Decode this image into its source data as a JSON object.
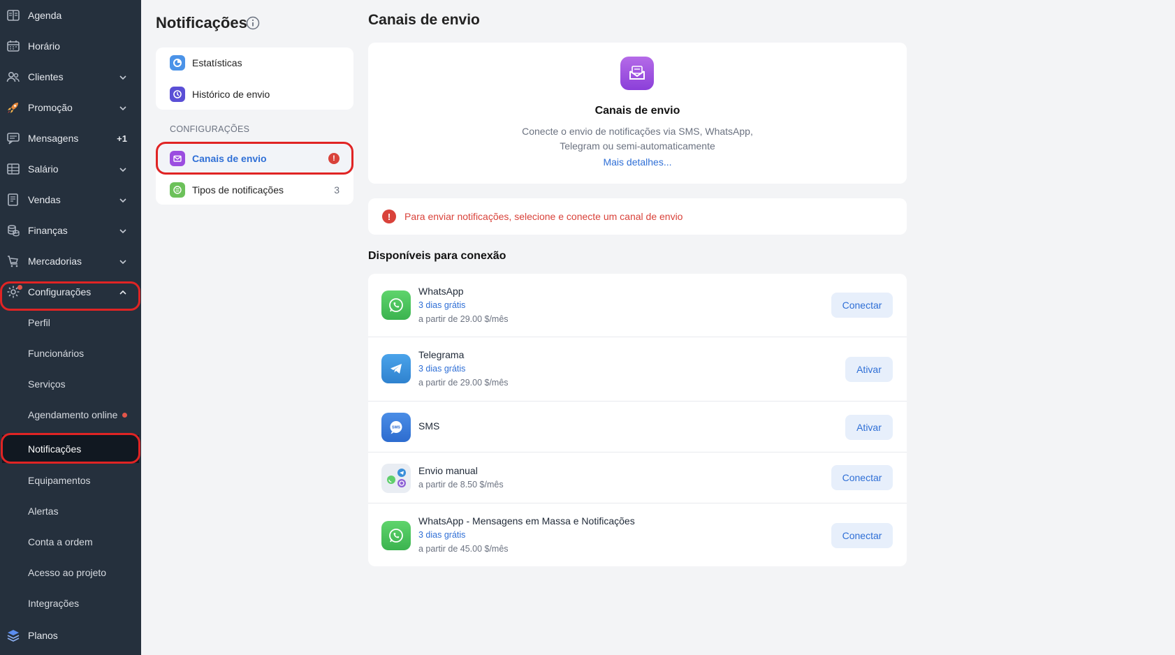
{
  "sidebar": {
    "items": [
      {
        "label": "Agenda",
        "icon": "calendar-book-icon"
      },
      {
        "label": "Horário",
        "icon": "calendar-icon"
      },
      {
        "label": "Clientes",
        "icon": "users-icon"
      },
      {
        "label": "Promoção",
        "icon": "rocket-icon"
      },
      {
        "label": "Mensagens",
        "icon": "message-icon",
        "badge": "+1"
      },
      {
        "label": "Salário",
        "icon": "salary-icon"
      },
      {
        "label": "Vendas",
        "icon": "sales-icon"
      },
      {
        "label": "Finanças",
        "icon": "coins-icon"
      },
      {
        "label": "Mercadorias",
        "icon": "cart-icon"
      },
      {
        "label": "Configurações",
        "icon": "gear-icon"
      }
    ],
    "subitems": [
      {
        "label": "Perfil"
      },
      {
        "label": "Funcionários"
      },
      {
        "label": "Serviços"
      },
      {
        "label": "Agendamento online"
      },
      {
        "label": "Notificações"
      },
      {
        "label": "Equipamentos"
      },
      {
        "label": "Alertas"
      },
      {
        "label": "Conta a ordem"
      },
      {
        "label": "Acesso ao projeto"
      },
      {
        "label": "Integrações"
      }
    ],
    "bottom": {
      "label": "Planos",
      "icon": "layers-icon"
    }
  },
  "notifications_menu": {
    "title": "Notificações",
    "top_items": [
      {
        "label": "Estatísticas",
        "icon": "stats-icon"
      },
      {
        "label": "Histórico de envio",
        "icon": "history-icon"
      }
    ],
    "section_label": "CONFIGURAÇÕES",
    "config_items": [
      {
        "label": "Canais de envio",
        "icon": "mail-icon",
        "alert": "!"
      },
      {
        "label": "Tipos de notificações",
        "icon": "list-icon",
        "count": "3"
      }
    ]
  },
  "main": {
    "title": "Canais de envio",
    "hero": {
      "title": "Canais de envio",
      "desc_line1": "Conecte o envio de notificações via SMS, WhatsApp,",
      "desc_line2": "Telegram ou semi-automaticamente",
      "link": "Mais detalhes..."
    },
    "alert": "Para enviar notificações, selecione e conecte um canal de envio",
    "available_title": "Disponíveis para conexão",
    "channels": [
      {
        "name": "WhatsApp",
        "trial": "3 dias grátis",
        "price": "a partir de 29.00 $/mês",
        "button": "Conectar",
        "icon": "whatsapp-icon"
      },
      {
        "name": "Telegrama",
        "trial": "3 dias grátis",
        "price": "a partir de 29.00 $/mês",
        "button": "Ativar",
        "icon": "telegram-icon"
      },
      {
        "name": "SMS",
        "button": "Ativar",
        "icon": "sms-icon"
      },
      {
        "name": "Envio manual",
        "price": "a partir de 8.50 $/mês",
        "button": "Conectar",
        "icon": "manual-send-icon"
      },
      {
        "name": "WhatsApp - Mensagens em Massa e Notificações",
        "trial": "3 dias grátis",
        "price": "a partir de 45.00 $/mês",
        "button": "Conectar",
        "icon": "whatsapp-icon"
      }
    ]
  },
  "colors": {
    "sidebar_bg": "#25303d",
    "accent_blue": "#2f6fd6",
    "alert_red": "#d9423a",
    "highlight_red": "#e02424",
    "whatsapp_green": "#4cc764",
    "telegram_blue": "#3a8fd9",
    "purple": "#9b4de0"
  }
}
